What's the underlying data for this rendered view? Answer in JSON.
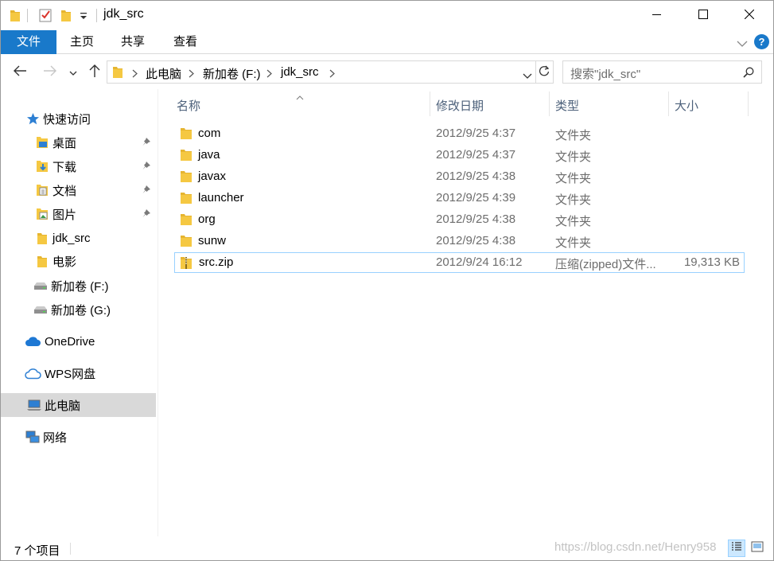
{
  "window": {
    "title": "jdk_src",
    "minimize_icon": "minimize-icon",
    "maximize_icon": "maximize-icon",
    "close_icon": "close-icon"
  },
  "ribbon": {
    "tabs": [
      "文件",
      "主页",
      "共享",
      "查看"
    ],
    "accent": "#1979ca",
    "help_label": "?"
  },
  "address": {
    "crumbs": [
      "此电脑",
      "新加卷 (F:)",
      "jdk_src"
    ],
    "search_placeholder": "搜索\"jdk_src\""
  },
  "nav": {
    "quick_access": "快速访问",
    "items": [
      {
        "label": "桌面",
        "icon": "desktop-icon",
        "pinned": true
      },
      {
        "label": "下载",
        "icon": "download-icon",
        "pinned": true
      },
      {
        "label": "文档",
        "icon": "document-icon",
        "pinned": true
      },
      {
        "label": "图片",
        "icon": "picture-icon",
        "pinned": true
      },
      {
        "label": "jdk_src",
        "icon": "folder-icon",
        "pinned": false
      },
      {
        "label": "电影",
        "icon": "folder-icon",
        "pinned": false
      },
      {
        "label": "新加卷 (F:)",
        "icon": "drive-icon",
        "pinned": false
      },
      {
        "label": "新加卷 (G:)",
        "icon": "drive-icon",
        "pinned": false
      }
    ],
    "onedrive": "OneDrive",
    "wps": "WPS网盘",
    "this_pc": "此电脑",
    "network": "网络"
  },
  "columns": {
    "name": "名称",
    "date": "修改日期",
    "type": "类型",
    "size": "大小"
  },
  "files": [
    {
      "name": "com",
      "date": "2012/9/25 4:37",
      "type": "文件夹",
      "size": "",
      "icon": "folder-icon"
    },
    {
      "name": "java",
      "date": "2012/9/25 4:37",
      "type": "文件夹",
      "size": "",
      "icon": "folder-icon"
    },
    {
      "name": "javax",
      "date": "2012/9/25 4:38",
      "type": "文件夹",
      "size": "",
      "icon": "folder-icon"
    },
    {
      "name": "launcher",
      "date": "2012/9/25 4:39",
      "type": "文件夹",
      "size": "",
      "icon": "folder-icon"
    },
    {
      "name": "org",
      "date": "2012/9/25 4:38",
      "type": "文件夹",
      "size": "",
      "icon": "folder-icon"
    },
    {
      "name": "sunw",
      "date": "2012/9/25 4:38",
      "type": "文件夹",
      "size": "",
      "icon": "folder-icon"
    },
    {
      "name": "src.zip",
      "date": "2012/9/24 16:12",
      "type": "压缩(zipped)文件...",
      "size": "19,313 KB",
      "icon": "zip-icon"
    }
  ],
  "status": {
    "count": "7 个项目",
    "watermark": "https://blog.csdn.net/Henry958"
  },
  "colors": {
    "folder": "#f5c842",
    "selection_border": "#99d1ff",
    "header_text": "#4c607a"
  }
}
